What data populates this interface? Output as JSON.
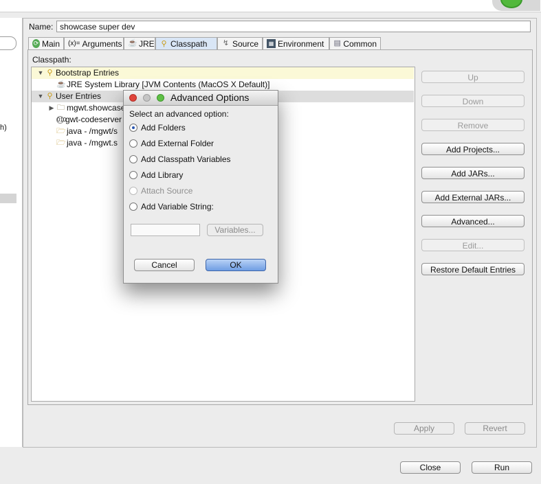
{
  "name_label": "Name:",
  "name_value": "showcase super dev",
  "tabs": [
    {
      "label": "Main",
      "icon": "run-icon"
    },
    {
      "label": "Arguments",
      "icon": "arguments-icon"
    },
    {
      "label": "JRE",
      "icon": "jre-icon"
    },
    {
      "label": "Classpath",
      "icon": "classpath-icon"
    },
    {
      "label": "Source",
      "icon": "source-icon"
    },
    {
      "label": "Environment",
      "icon": "environment-icon"
    },
    {
      "label": "Common",
      "icon": "common-icon"
    }
  ],
  "classpath_label": "Classpath:",
  "tree": {
    "bootstrap": "Bootstrap Entries",
    "jre_library": "JRE System Library [JVM Contents (MacOS X Default)]",
    "user_entries": "User Entries",
    "item1": "mgwt.showcase",
    "item2": "gwt-codeserver",
    "item3": "java - /mgwt/s",
    "item4": "java - /mgwt.s"
  },
  "side_buttons": {
    "up": "Up",
    "down": "Down",
    "remove": "Remove",
    "add_projects": "Add Projects...",
    "add_jars": "Add JARs...",
    "add_external_jars": "Add External JARs...",
    "advanced": "Advanced...",
    "edit": "Edit...",
    "restore": "Restore Default Entries"
  },
  "bottom": {
    "apply": "Apply",
    "revert": "Revert",
    "close": "Close",
    "run": "Run"
  },
  "left_fragment": "h)",
  "dialog": {
    "title": "Advanced Options",
    "prompt": "Select an advanced option:",
    "options": {
      "add_folders": "Add Folders",
      "add_external_folder": "Add External Folder",
      "add_classpath_variables": "Add Classpath Variables",
      "add_library": "Add Library",
      "attach_source": "Attach Source",
      "add_variable_string": "Add Variable String:"
    },
    "variable_value": "",
    "variables_button": "Variables...",
    "cancel": "Cancel",
    "ok": "OK"
  },
  "colors": {
    "selected_tab": "#d9e6f6",
    "bootstrap_row": "#fbf9d7",
    "ok_button": "#7aa6e8"
  }
}
